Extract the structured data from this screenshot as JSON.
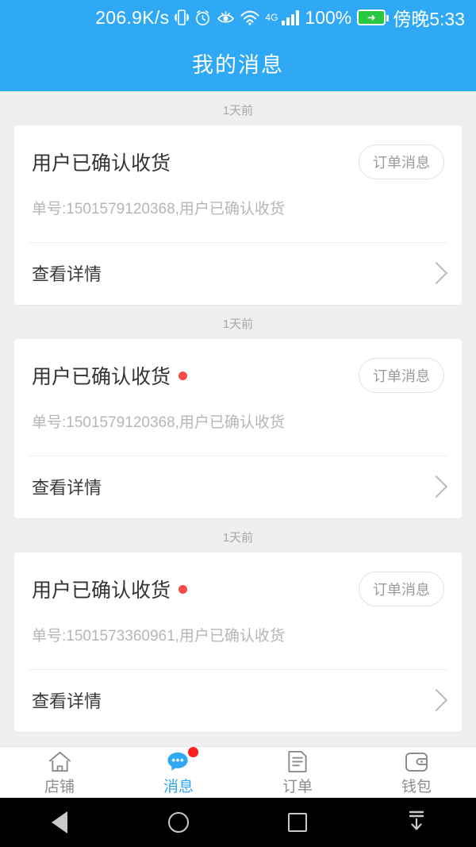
{
  "status_bar": {
    "net_speed": "206.9K/s",
    "icons": [
      "vibrate-icon",
      "alarm-icon",
      "eye-comfort-icon",
      "wifi-icon",
      "signal-icon"
    ],
    "network_type": "4G",
    "battery_percent": "100%",
    "time": "傍晚5:33"
  },
  "header": {
    "title": "我的消息"
  },
  "colors": {
    "accent": "#2fa8f6",
    "unread_dot": "#fb4a46",
    "badge_dot": "#fb201b",
    "background": "#efefef",
    "card": "#ffffff"
  },
  "messages": [
    {
      "time_label": "1天前",
      "title": "用户已确认收货",
      "unread": false,
      "tag": "订单消息",
      "body": "单号:1501579120368,用户已确认收货",
      "action": "查看详情"
    },
    {
      "time_label": "1天前",
      "title": "用户已确认收货",
      "unread": true,
      "tag": "订单消息",
      "body": "单号:1501579120368,用户已确认收货",
      "action": "查看详情"
    },
    {
      "time_label": "1天前",
      "title": "用户已确认收货",
      "unread": true,
      "tag": "订单消息",
      "body": "单号:1501573360961,用户已确认收货",
      "action": "查看详情"
    }
  ],
  "tabbar": {
    "items": [
      {
        "label": "店铺",
        "icon": "home-icon",
        "active": false,
        "badge": false
      },
      {
        "label": "消息",
        "icon": "chat-bubble-icon",
        "active": true,
        "badge": true
      },
      {
        "label": "订单",
        "icon": "document-icon",
        "active": false,
        "badge": false
      },
      {
        "label": "钱包",
        "icon": "wallet-icon",
        "active": false,
        "badge": false
      }
    ]
  },
  "android_nav": {
    "back": "back-icon",
    "home": "home-circle-icon",
    "recents": "recents-icon",
    "hide": "hide-navbar-icon"
  }
}
